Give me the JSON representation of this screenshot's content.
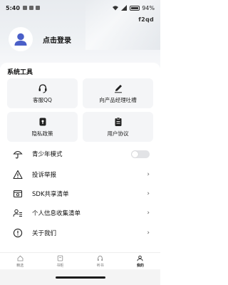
{
  "status_bar": {
    "time": "5:40",
    "battery": "94%"
  },
  "header": {
    "corner_label": "f2qd",
    "login_text": "点击登录"
  },
  "system_tools": {
    "title": "系统工具",
    "tiles": [
      {
        "label": "客服QQ",
        "icon": "headset-icon"
      },
      {
        "label": "向产品经理吐槽",
        "icon": "pencil-icon"
      },
      {
        "label": "隐私政策",
        "icon": "shield-icon"
      },
      {
        "label": "用户协议",
        "icon": "clipboard-icon"
      }
    ]
  },
  "menu": [
    {
      "label": "青少年模式",
      "icon": "umbrella-icon",
      "control": "toggle",
      "toggle_on": false
    },
    {
      "label": "投诉举报",
      "icon": "warning-icon",
      "control": "chevron"
    },
    {
      "label": "SDK共享清单",
      "icon": "sdk-box-icon",
      "control": "chevron"
    },
    {
      "label": "个人信息收集清单",
      "icon": "person-list-icon",
      "control": "chevron"
    },
    {
      "label": "关于我们",
      "icon": "info-icon",
      "control": "chevron"
    }
  ],
  "chevron_glyph": "›",
  "tabs": [
    {
      "label": "精选",
      "icon": "home-icon",
      "active": false
    },
    {
      "label": "书柜",
      "icon": "bookshelf-icon",
      "active": false
    },
    {
      "label": "听书",
      "icon": "headphones-icon",
      "active": false
    },
    {
      "label": "我的",
      "icon": "person-icon",
      "active": true
    }
  ],
  "colors": {
    "accent": "#1a1a1a",
    "tile_bg": "#f4f5f7",
    "toggle_off": "#e2e3e6",
    "avatar_blue": "#4a5fc8"
  }
}
